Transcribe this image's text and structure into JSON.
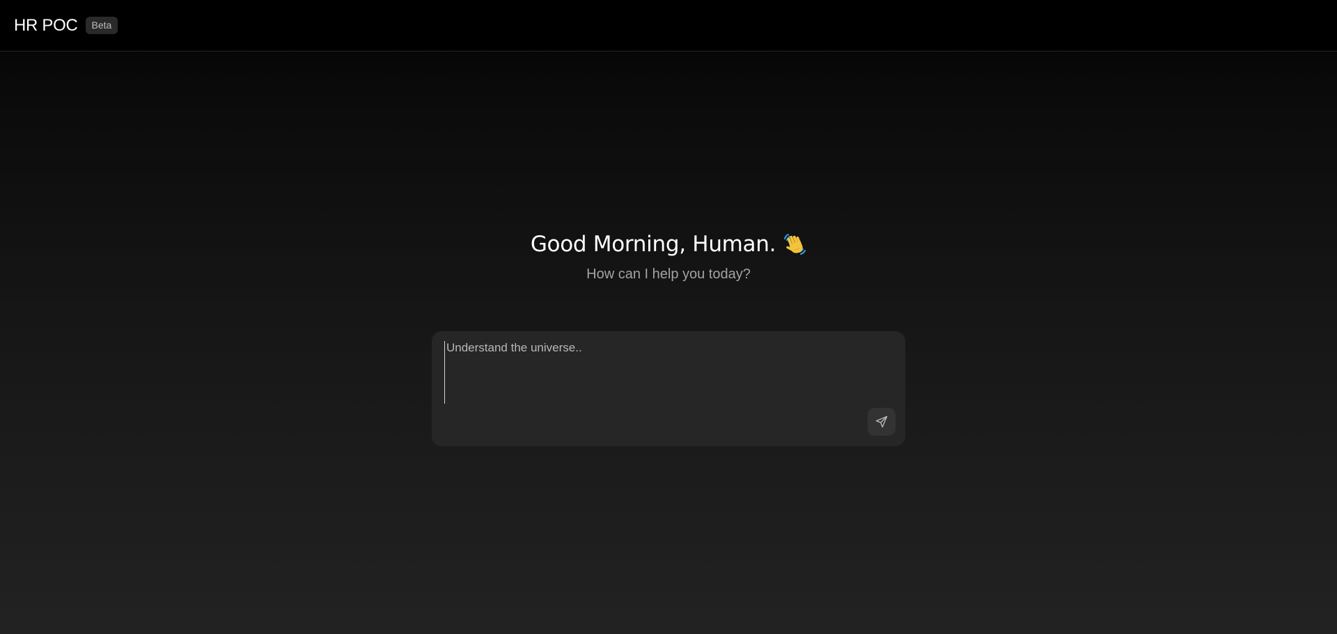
{
  "header": {
    "title": "HR POC",
    "badge": "Beta"
  },
  "hero": {
    "greeting": "Good Morning, Human.",
    "greeting_icon": "waving-hand-icon",
    "subtitle": "How can I help you today?"
  },
  "composer": {
    "placeholder": "Understand the universe..",
    "value": "",
    "send_icon": "send-icon"
  },
  "colors": {
    "background_top": "#000000",
    "background_bottom": "#222222",
    "composer_bg": "#262626",
    "badge_bg": "#2a2a2a",
    "subtitle_text": "#a3a3a3"
  }
}
